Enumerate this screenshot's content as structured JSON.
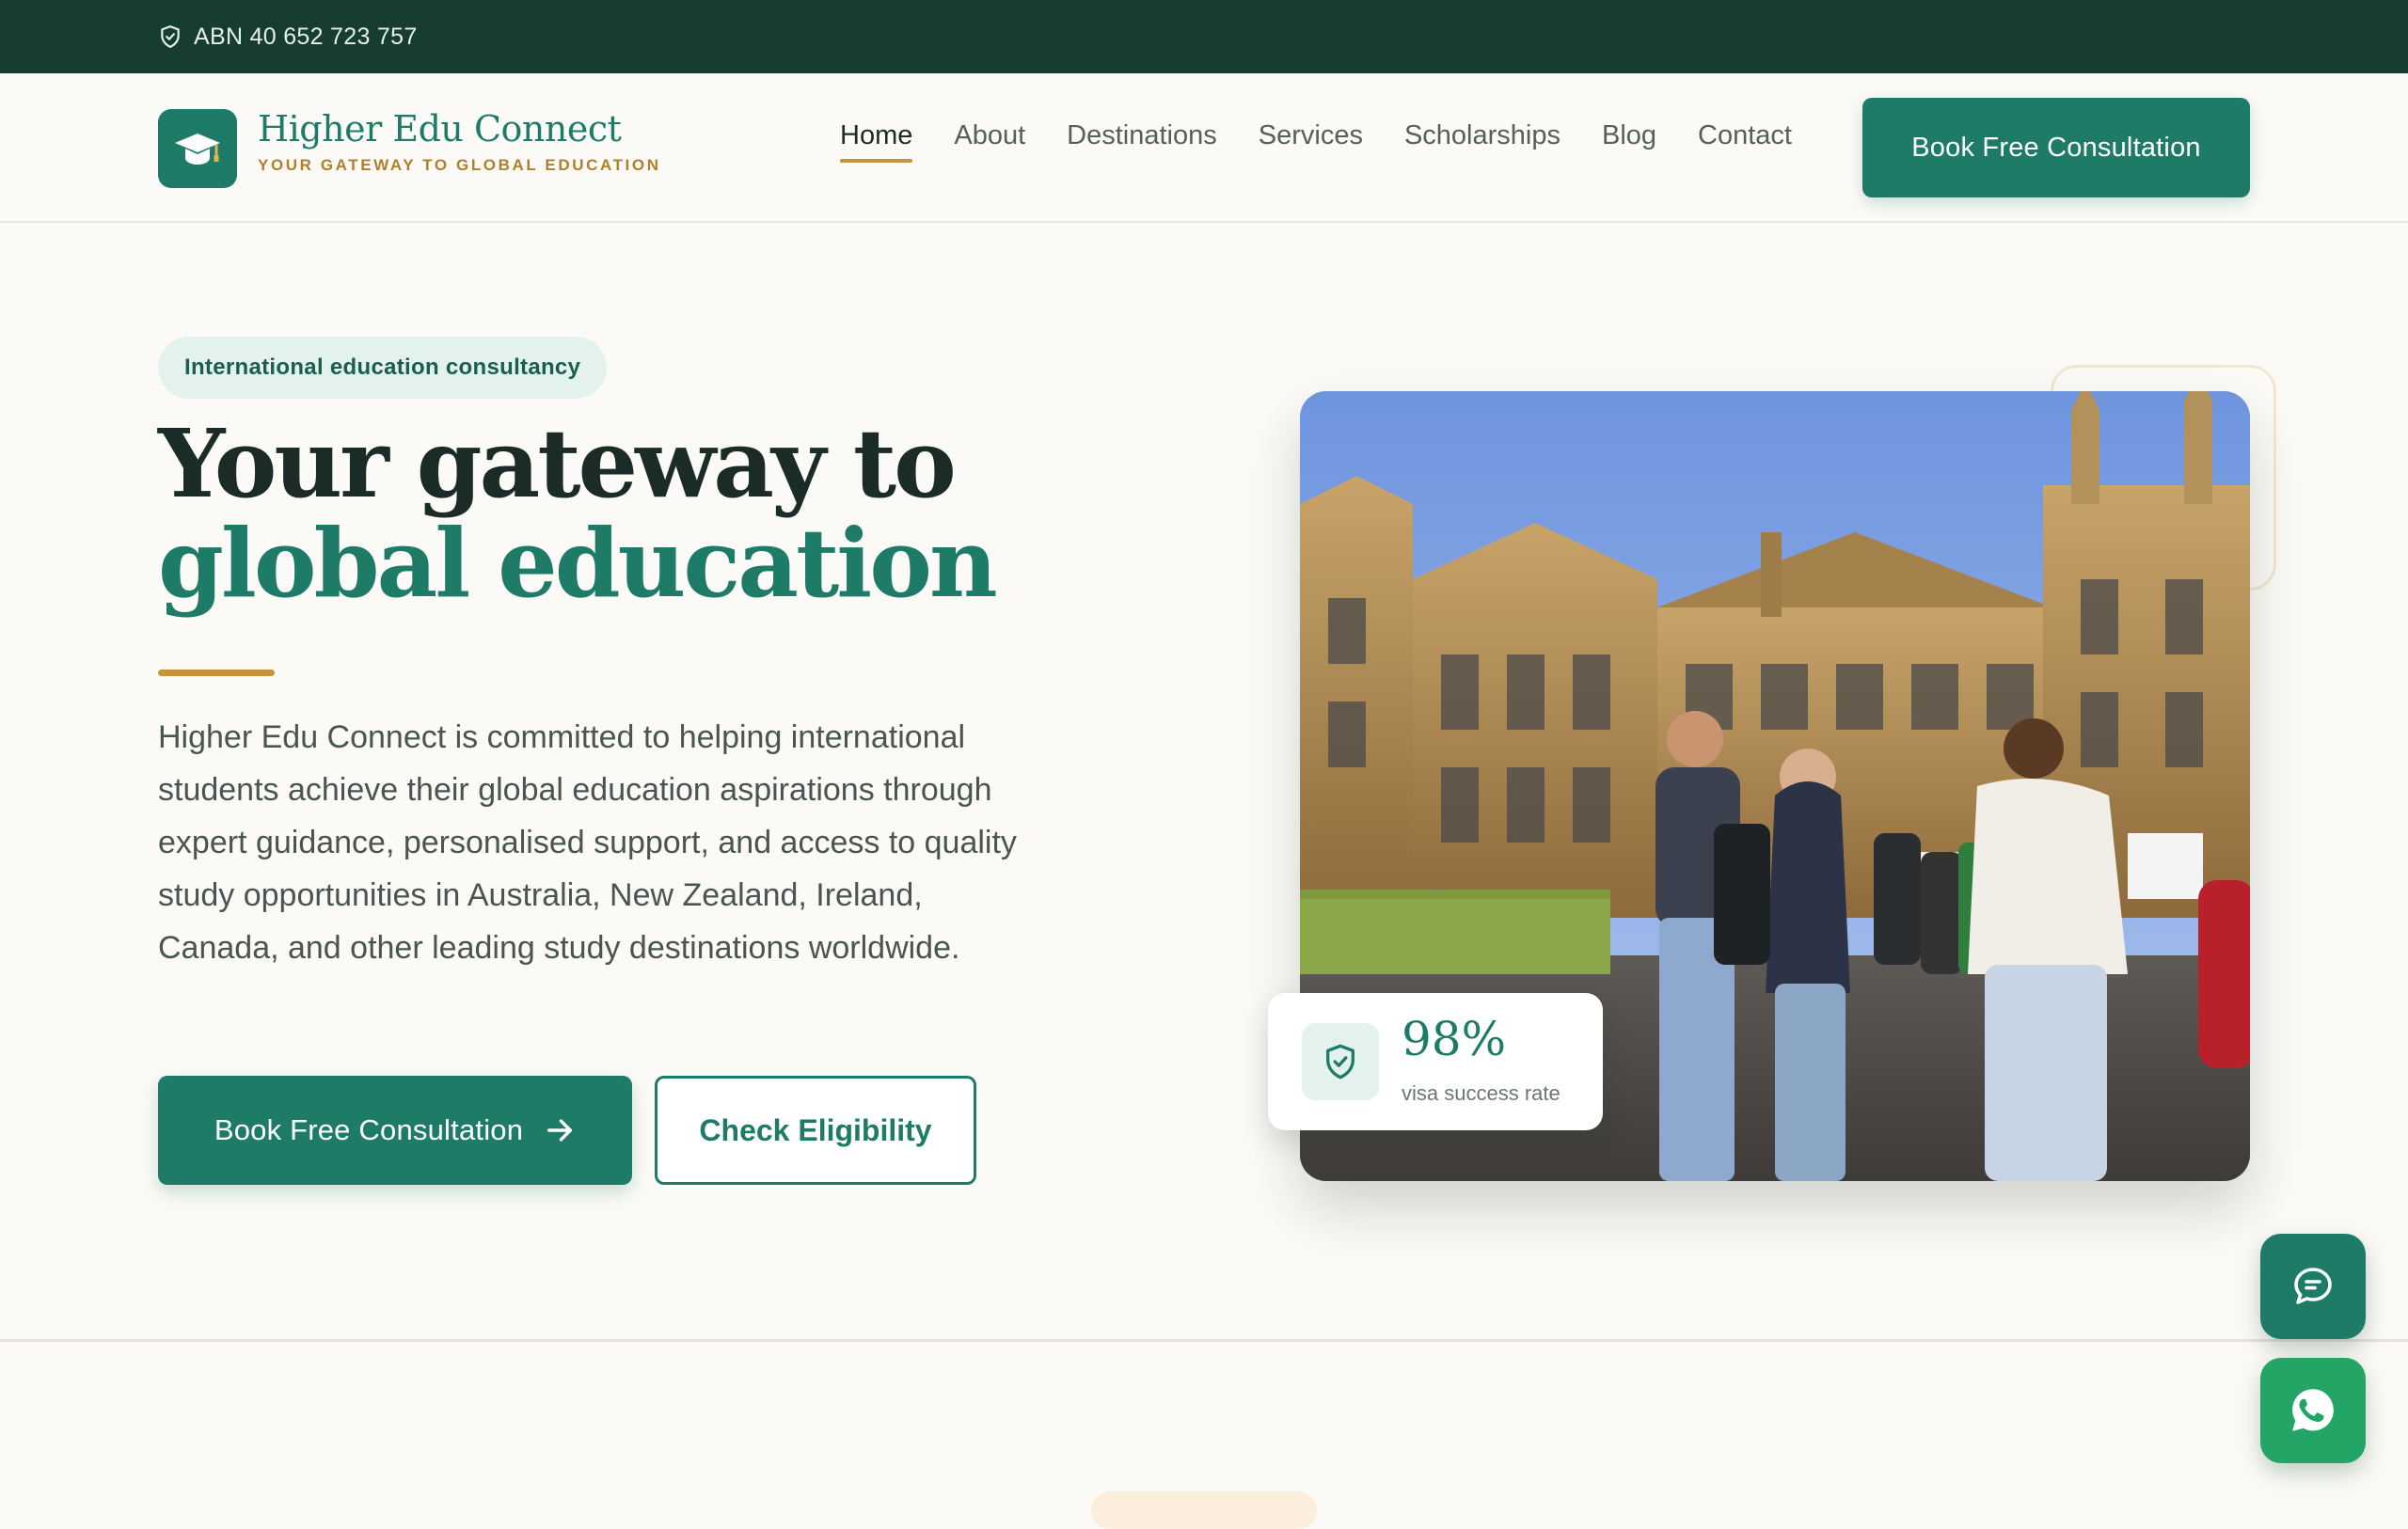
{
  "topbar": {
    "abn": "ABN 40 652 723 757",
    "icon": "shield-check-icon"
  },
  "brand": {
    "name": "Higher Edu Connect",
    "tagline": "YOUR GATEWAY TO GLOBAL EDUCATION",
    "icon": "graduation-cap-icon"
  },
  "nav": {
    "items": [
      {
        "label": "Home",
        "active": true
      },
      {
        "label": "About"
      },
      {
        "label": "Destinations"
      },
      {
        "label": "Services"
      },
      {
        "label": "Scholarships"
      },
      {
        "label": "Blog"
      },
      {
        "label": "Contact"
      }
    ],
    "cta_label": "Book Free Consultation"
  },
  "hero": {
    "pill": "International education consultancy",
    "title_part1": "Your gateway to ",
    "title_accent": "global education",
    "description": "Higher Edu Connect is committed to helping international students achieve their global education aspirations through expert guidance, personalised support, and access to quality study opportunities in Australia, New Zealand, Ireland, Canada, and other leading study destinations worldwide.",
    "primary_button": "Book Free Consultation",
    "secondary_button": "Check Eligibility"
  },
  "stat": {
    "value": "98%",
    "label": "visa success rate",
    "icon": "shield-check-icon"
  },
  "fabs": {
    "chat_icon": "chat-bubble-icon",
    "whatsapp_icon": "whatsapp-icon"
  },
  "colors": {
    "brand_green": "#1E7B67",
    "dark_green": "#173D33",
    "gold": "#C7943A",
    "background": "#FBFAF6",
    "whatsapp": "#22A565"
  }
}
